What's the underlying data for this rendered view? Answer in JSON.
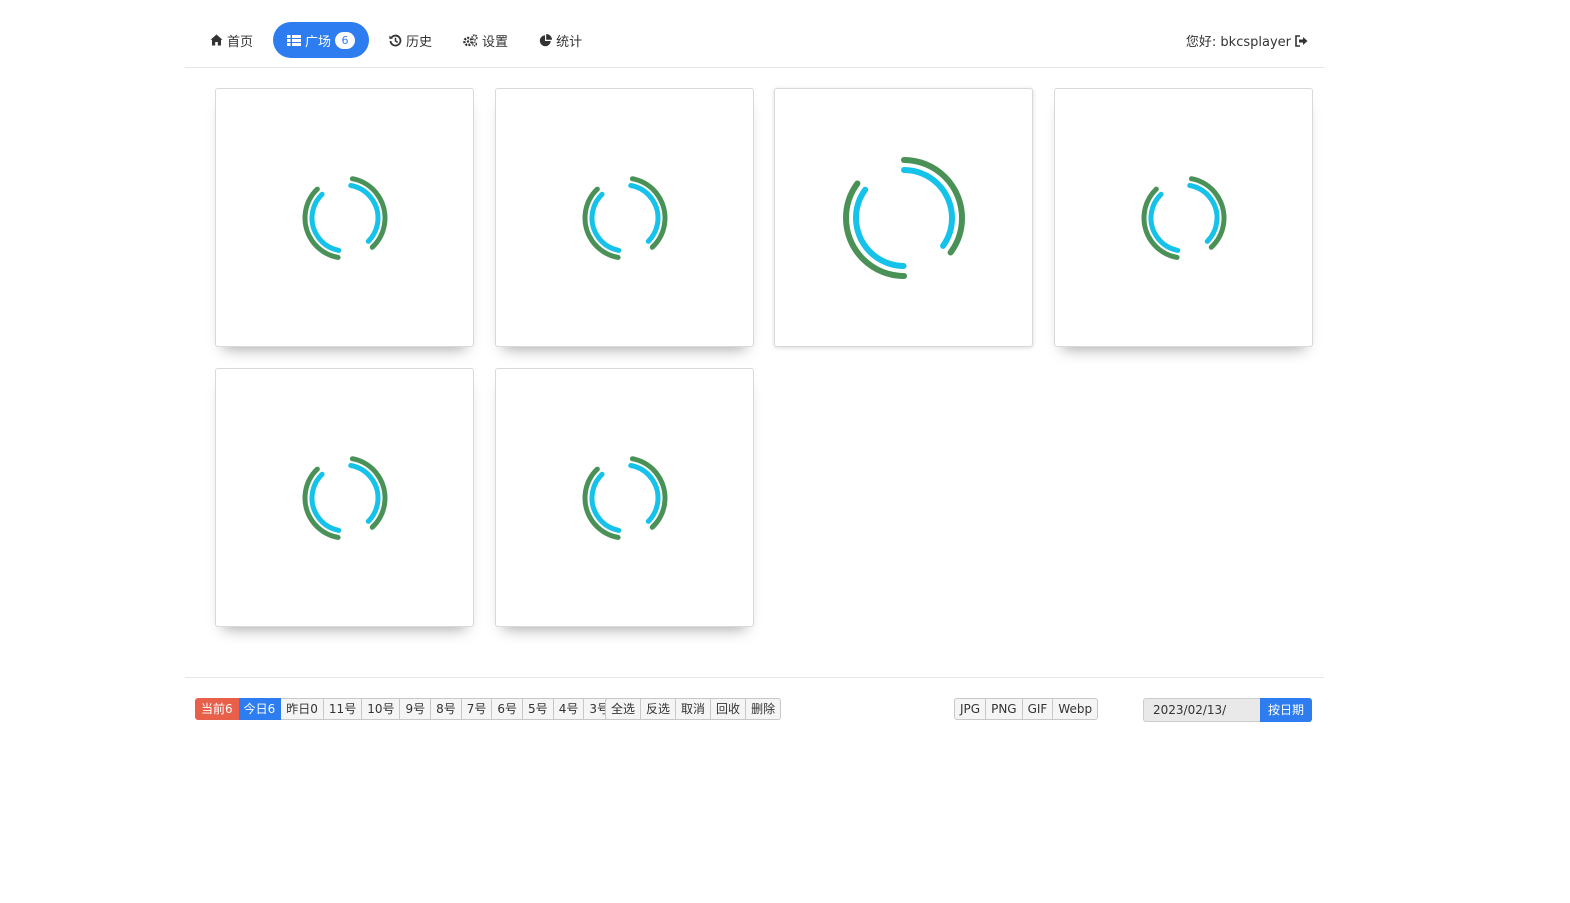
{
  "nav": {
    "items": [
      {
        "label": "首页",
        "icon": "home-icon"
      },
      {
        "label": "广场",
        "icon": "grid-icon",
        "badge": "6",
        "active": true
      },
      {
        "label": "历史",
        "icon": "history-icon"
      },
      {
        "label": "设置",
        "icon": "gears-icon"
      },
      {
        "label": "统计",
        "icon": "pie-chart-icon"
      }
    ],
    "greeting": "您好: bkcsplayer",
    "logout_icon": "logout-icon"
  },
  "grid": {
    "cards": [
      {
        "state": "loading"
      },
      {
        "state": "loading"
      },
      {
        "state": "loading",
        "hovered": true
      },
      {
        "state": "loading"
      },
      {
        "state": "loading"
      },
      {
        "state": "loading"
      }
    ],
    "spinner_colors": {
      "outer": "#4a9157",
      "inner": "#14c2ea"
    }
  },
  "filter_bar": {
    "days": [
      {
        "label": "当前6",
        "style": "red"
      },
      {
        "label": "今日6",
        "style": "blue"
      },
      {
        "label": "昨日0"
      },
      {
        "label": "11号"
      },
      {
        "label": "10号"
      },
      {
        "label": "9号"
      },
      {
        "label": "8号"
      },
      {
        "label": "7号"
      },
      {
        "label": "6号"
      },
      {
        "label": "5号"
      },
      {
        "label": "4号"
      },
      {
        "label": "3号"
      }
    ],
    "actions": [
      "全选",
      "反选",
      "取消",
      "回收",
      "删除"
    ],
    "formats": [
      "JPG",
      "PNG",
      "GIF",
      "Webp"
    ],
    "date_value": "2023/02/13/",
    "date_button": "按日期"
  },
  "colors": {
    "accent": "#2d7cf0",
    "current": "#e8604a"
  }
}
